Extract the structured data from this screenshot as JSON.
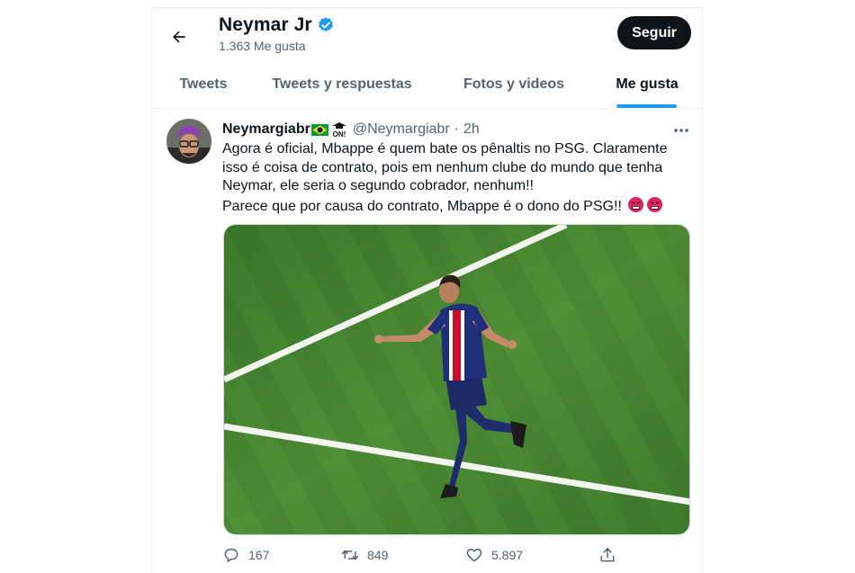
{
  "header": {
    "name": "Neymar Jr",
    "likes": "1.363 Me gusta",
    "follow_label": "Seguir"
  },
  "tabs": [
    {
      "label": "Tweets",
      "active": false
    },
    {
      "label": "Tweets y respuestas",
      "active": false
    },
    {
      "label": "Fotos y videos",
      "active": false
    },
    {
      "label": "Me gusta",
      "active": true
    }
  ],
  "tweet": {
    "author_name": "Neymargiabr",
    "author_handle": "@Neymargiabr",
    "separator": "·",
    "time": "2h",
    "text_lines": [
      "Agora é oficial, Mbappe é quem bate os pênaltis no PSG. Claramente isso é coisa de contrato, pois em nenhum clube do mundo que tenha Neymar, ele seria o segundo cobrador, nenhum!!",
      "Parece que por causa do contrato, Mbappe é o dono do PSG!!"
    ],
    "media_icon": "football-player-photo",
    "actions": {
      "replies": "167",
      "retweets": "849",
      "likes": "5.897"
    }
  },
  "icons": {
    "back": "arrow-left-icon",
    "verified": "verified-badge-icon",
    "flag": "brazil-flag-icon",
    "on_badge": "on-arrow-badge-icon",
    "more": "more-dots-icon",
    "reply": "reply-icon",
    "retweet": "retweet-icon",
    "like": "heart-icon",
    "share": "share-icon",
    "angry": "angry-face-icon"
  },
  "colors": {
    "accent": "#1d9bf0",
    "text_primary": "#0f1419",
    "text_secondary": "#536471",
    "angry_red": "#e0245e"
  }
}
